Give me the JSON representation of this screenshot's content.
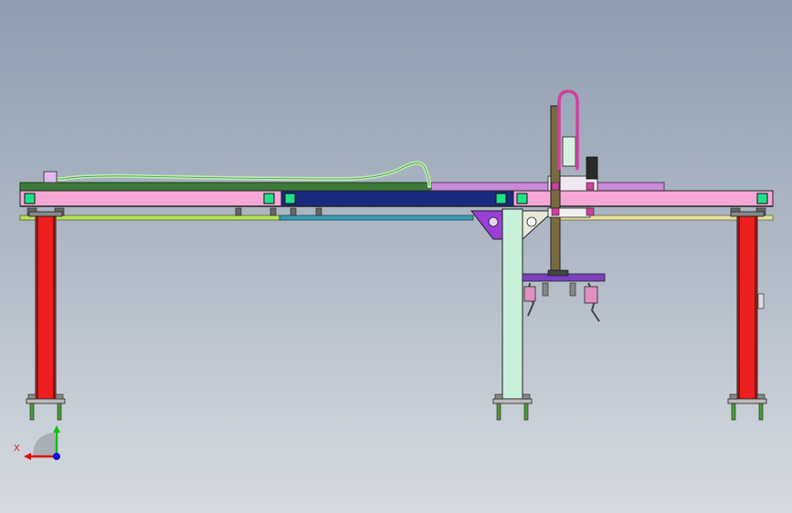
{
  "viewport": {
    "background_top": "#8f9db0",
    "background_bottom": "#d7dbe0"
  },
  "model": {
    "colors": {
      "beam_left": "#f5a8d6",
      "beam_middle": "#1a2a80",
      "beam_right": "#f5a8d6",
      "beam_outline": "#222222",
      "top_plate_green": "#3d7a3a",
      "top_plate_purple": "#c98ad8",
      "rail_left": "#b8e05a",
      "rail_middle": "#3a9ab0",
      "rail_right": "#e8e0a0",
      "leg_red": "#ee1f1f",
      "leg_center": "#c8f0d8",
      "connector_green": "#20e08a",
      "cable_hose": "#b8f0b0",
      "carriage_plate": "#9a40d8",
      "vertical_column": "#7a6a40",
      "loop_hose": "#d040a0",
      "gripper": "#7a40c0",
      "anchor_bolt": "#4a9a3a"
    }
  },
  "triad": {
    "x_label": "X",
    "x_color": "#e01010",
    "y_color": "#10c010",
    "z_color": "#1010e0"
  }
}
